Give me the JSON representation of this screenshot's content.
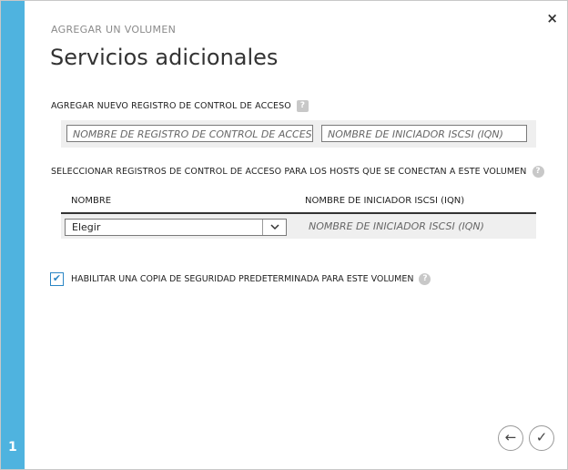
{
  "wizard": {
    "step_number": "1",
    "label": "AGREGAR UN VOLUMEN",
    "title": "Servicios adicionales",
    "close_glyph": "×"
  },
  "add_record": {
    "label": "AGREGAR NUEVO REGISTRO DE CONTROL DE ACCESO",
    "help_glyph": "?",
    "name_placeholder": "NOMBRE DE REGISTRO DE CONTROL DE ACCESO",
    "iqn_placeholder": "NOMBRE DE INICIADOR ISCSI (IQN)"
  },
  "select_records": {
    "label": "SELECCIONAR REGISTROS DE CONTROL DE ACCESO PARA LOS HOSTS QUE SE CONECTAN A ESTE VOLUMEN",
    "help_glyph": "?",
    "columns": [
      "NOMBRE",
      "NOMBRE DE INICIADOR ISCSI (IQN)"
    ],
    "row": {
      "dropdown_value": "Elegir",
      "dropdown_icon": "chevron-down-icon",
      "iqn_placeholder": "NOMBRE DE INICIADOR ISCSI (IQN)"
    }
  },
  "backup": {
    "checked": true,
    "checkmark_glyph": "✔",
    "label": "HABILITAR UNA COPIA DE SEGURIDAD PREDETERMINADA PARA ESTE VOLUMEN",
    "help_glyph": "?"
  },
  "nav": {
    "back_glyph": "←",
    "finish_glyph": "✓"
  },
  "colors": {
    "rail": "#4fb3df",
    "accent": "#2b86c5"
  }
}
